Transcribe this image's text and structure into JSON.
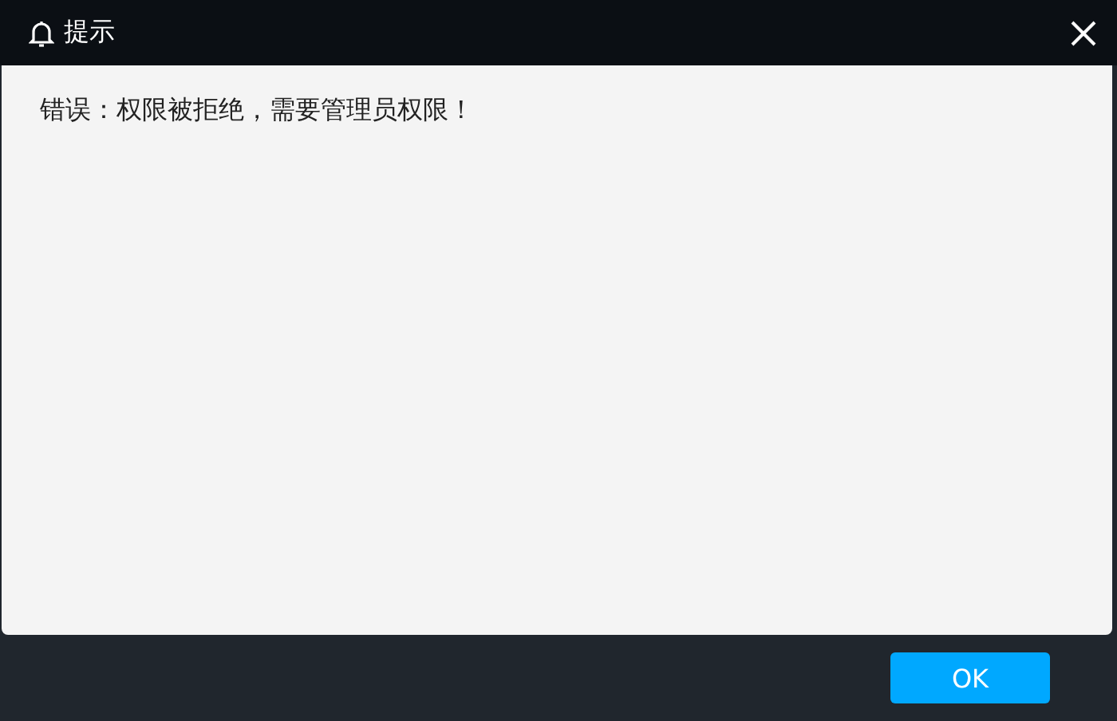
{
  "window": {
    "title": "提示"
  },
  "message": "错误：权限被拒绝，需要管理员权限！",
  "buttons": [
    "OK"
  ]
}
